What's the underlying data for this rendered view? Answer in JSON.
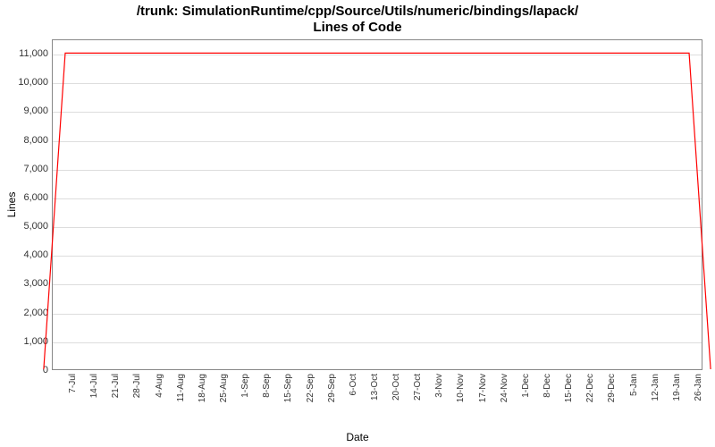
{
  "title_line1": "/trunk: SimulationRuntime/cpp/Source/Utils/numeric/bindings/lapack/",
  "title_line2": "Lines of Code",
  "xlabel": "Date",
  "ylabel": "Lines",
  "chart_data": {
    "type": "line",
    "xlabel": "Date",
    "ylabel": "Lines",
    "title": "/trunk: SimulationRuntime/cpp/Source/Utils/numeric/bindings/lapack/ Lines of Code",
    "ylim": [
      0,
      11500
    ],
    "y_ticks": [
      0,
      1000,
      2000,
      3000,
      4000,
      5000,
      6000,
      7000,
      8000,
      9000,
      10000,
      11000
    ],
    "y_tick_labels": [
      "0",
      "1,000",
      "2,000",
      "3,000",
      "4,000",
      "5,000",
      "6,000",
      "7,000",
      "8,000",
      "9,000",
      "10,000",
      "11,000"
    ],
    "x_ticks": [
      "7-Jul",
      "14-Jul",
      "21-Jul",
      "28-Jul",
      "4-Aug",
      "11-Aug",
      "18-Aug",
      "25-Aug",
      "1-Sep",
      "8-Sep",
      "15-Sep",
      "22-Sep",
      "29-Sep",
      "6-Oct",
      "13-Oct",
      "20-Oct",
      "27-Oct",
      "3-Nov",
      "10-Nov",
      "17-Nov",
      "24-Nov",
      "1-Dec",
      "8-Dec",
      "15-Dec",
      "22-Dec",
      "29-Dec",
      "5-Jan",
      "12-Jan",
      "19-Jan",
      "26-Jan"
    ],
    "series": [
      {
        "name": "Lines",
        "color": "#ff0000",
        "points": [
          {
            "x": "6-Jul",
            "y": 0
          },
          {
            "x": "7-Jul",
            "y": 11050
          },
          {
            "x": "26-Jan",
            "y": 11050
          },
          {
            "x": "27-Jan",
            "y": 0
          }
        ]
      }
    ]
  }
}
